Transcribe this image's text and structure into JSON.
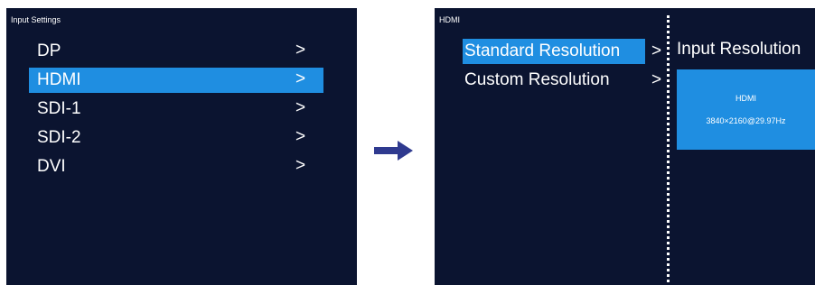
{
  "left_screen": {
    "title": "Input Settings",
    "items": [
      {
        "label": "DP",
        "chevron": ">"
      },
      {
        "label": "HDMI",
        "chevron": ">"
      },
      {
        "label": "SDI-1",
        "chevron": ">"
      },
      {
        "label": "SDI-2",
        "chevron": ">"
      },
      {
        "label": "DVI",
        "chevron": ">"
      }
    ],
    "selected_item": "HDMI"
  },
  "transition_icon": "right-arrow-icon",
  "right_screen": {
    "title": "HDMI",
    "items": [
      {
        "label": "Standard Resolution",
        "chevron": ">"
      },
      {
        "label": "Custom Resolution",
        "chevron": ">"
      }
    ],
    "selected_item": "Standard Resolution",
    "panel_heading": "Input Resolution",
    "info_source": "HDMI",
    "info_resolution": "3840×2160@29.97Hz"
  },
  "colors": {
    "screen_background": "#0b1430",
    "highlight": "#1f8ee1",
    "text": "#ffffff",
    "arrow": "#2f3a8f"
  }
}
